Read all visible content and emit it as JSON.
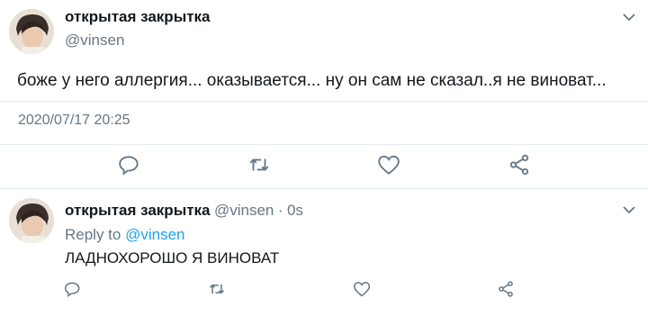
{
  "main_tweet": {
    "author_name": "открытая закрытка",
    "author_handle": "@vinsen",
    "text": "боже у него аллергия... оказывается... ну он сам не сказал..я не виноват...",
    "timestamp": "2020/07/17 20:25",
    "icons": [
      "chevron-down-icon",
      "reply-icon",
      "retweet-icon",
      "like-icon",
      "share-icon"
    ]
  },
  "reply_tweet": {
    "author_name": "открытая закрытка",
    "author_handle": "@vinsen",
    "separator": "·",
    "time_ago": "0s",
    "reply_to_prefix": "Reply to",
    "reply_to_handle": "@vinsen",
    "text": "ЛАДНОХОРОШО Я ВИНОВАТ",
    "icons": [
      "chevron-down-icon",
      "reply-icon",
      "retweet-icon",
      "like-icon",
      "share-icon"
    ]
  },
  "colors": {
    "link": "#1da1f2",
    "secondary_text": "#657786",
    "icon": "#657786",
    "divider": "#e6ecf0"
  }
}
